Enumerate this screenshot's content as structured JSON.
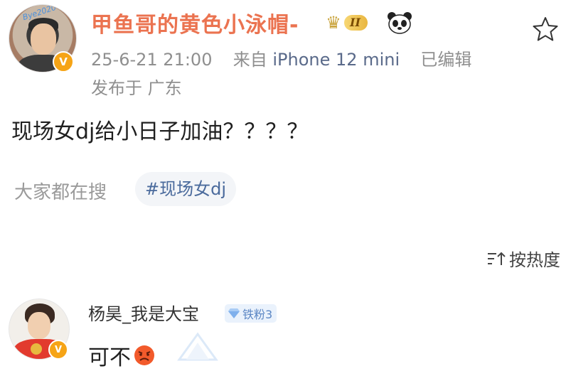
{
  "post": {
    "username": "甲鱼哥的黄色小泳帽-",
    "vip_level": "II",
    "avatar_tag": "Bye2020",
    "date": "25-6-21 21:00",
    "source_prefix": "来自",
    "source_device": "iPhone 12 mini",
    "edited": "已编辑",
    "location": "发布于 广东",
    "text": "现场女dj给小日子加油？？？？",
    "search_label": "大家都在搜",
    "topic": "#现场女dj",
    "sort_label": "按热度"
  },
  "comment": {
    "username": "杨昊_我是大宝",
    "fan_badge": "铁粉3",
    "text": "可不"
  },
  "icons": {
    "favorite": "star-outline-icon",
    "verified": "v-badge-icon",
    "vip": "crown-icon",
    "panda": "panda-icon",
    "sort": "sort-icon",
    "fan": "diamond-icon",
    "emoji": "angry-face-icon"
  },
  "colors": {
    "username": "#eb7350",
    "verified": "#f6a416",
    "topic": "#4a6a9c",
    "fan_badge": "#5b86c4"
  }
}
